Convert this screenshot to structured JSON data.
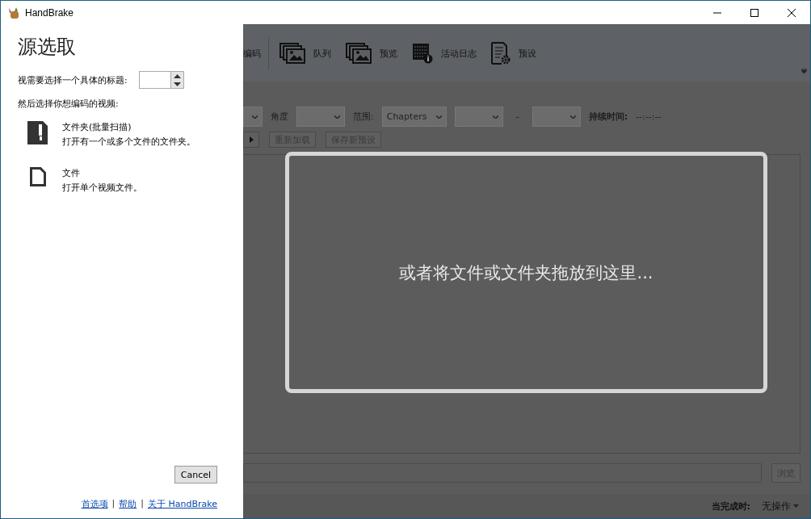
{
  "window": {
    "title": "HandBrake"
  },
  "source_panel": {
    "heading": "源选取",
    "title_label": "视需要选择一个具体的标题:",
    "choose_label": "然后选择你想编码的视频:",
    "options": [
      {
        "kind": "folder",
        "title": "文件夹(批量扫描)",
        "description": "打开有一个或多个文件的文件夹。"
      },
      {
        "kind": "file",
        "title": "文件",
        "description": "打开单个视频文件。"
      }
    ],
    "cancel": "Cancel",
    "links": [
      "首选项",
      "帮助",
      "关于 HandBrake"
    ],
    "link_separators": [
      "|",
      "|"
    ]
  },
  "toolbar": [
    {
      "kind": "text",
      "label": "编码"
    },
    {
      "kind": "queue",
      "label": "队列"
    },
    {
      "kind": "preview",
      "label": "预览"
    },
    {
      "kind": "log",
      "label": "活动日志"
    },
    {
      "kind": "presets",
      "label": "预设"
    }
  ],
  "source_row": {
    "angle_label": "角度",
    "range_label": "范围:",
    "range_value": "Chapters",
    "dash": "-",
    "duration_label": "持续时间:",
    "duration_value": "--:--:--"
  },
  "preset_buttons": [
    "重新加载",
    "保存新预设"
  ],
  "drop_zone": {
    "text": "或者将文件或文件夹拖放到这里..."
  },
  "browse_button": "浏览",
  "status_bar": {
    "when_done_label": "当完成时:",
    "when_done_value": "无操作"
  }
}
